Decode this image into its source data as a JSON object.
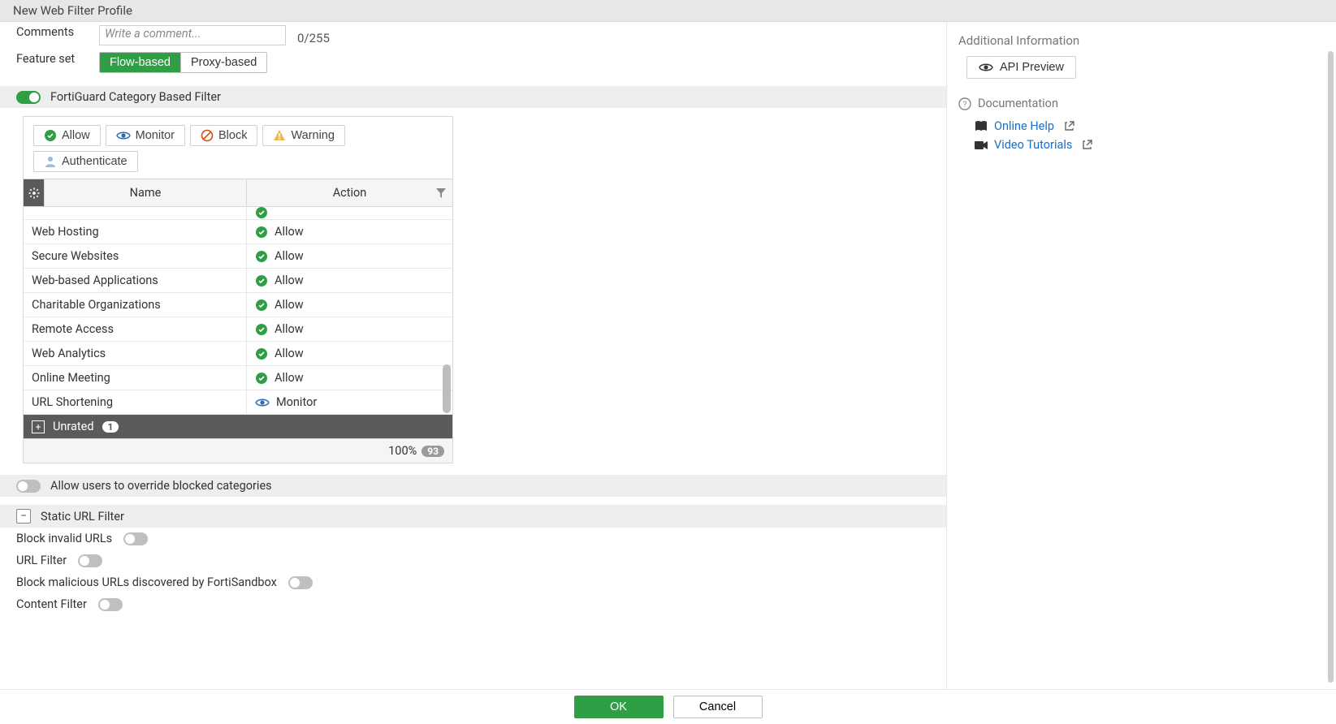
{
  "title": "New Web Filter Profile",
  "comments": {
    "label": "Comments",
    "placeholder": "Write a comment...",
    "value": "",
    "count": "0/255"
  },
  "feature_set": {
    "label": "Feature set",
    "options": [
      "Flow-based",
      "Proxy-based"
    ],
    "selected": "Flow-based"
  },
  "category_filter": {
    "title": "FortiGuard Category Based Filter",
    "enabled": true,
    "action_buttons": {
      "allow": "Allow",
      "monitor": "Monitor",
      "block": "Block",
      "warning": "Warning",
      "authenticate": "Authenticate"
    },
    "columns": {
      "name": "Name",
      "action": "Action"
    },
    "rows": [
      {
        "name": "Web Hosting",
        "action": "Allow",
        "action_type": "allow"
      },
      {
        "name": "Secure Websites",
        "action": "Allow",
        "action_type": "allow"
      },
      {
        "name": "Web-based Applications",
        "action": "Allow",
        "action_type": "allow"
      },
      {
        "name": "Charitable Organizations",
        "action": "Allow",
        "action_type": "allow"
      },
      {
        "name": "Remote Access",
        "action": "Allow",
        "action_type": "allow"
      },
      {
        "name": "Web Analytics",
        "action": "Allow",
        "action_type": "allow"
      },
      {
        "name": "Online Meeting",
        "action": "Allow",
        "action_type": "allow"
      },
      {
        "name": "URL Shortening",
        "action": "Monitor",
        "action_type": "monitor"
      }
    ],
    "group": {
      "label": "Unrated",
      "count": "1"
    },
    "footer": {
      "percent": "100%",
      "total": "93"
    }
  },
  "override": {
    "label": "Allow users to override blocked categories",
    "enabled": false
  },
  "static_url": {
    "title": "Static URL Filter",
    "rows": [
      {
        "label": "Block invalid URLs",
        "enabled": false
      },
      {
        "label": "URL Filter",
        "enabled": false
      },
      {
        "label": "Block malicious URLs discovered by FortiSandbox",
        "enabled": false
      },
      {
        "label": "Content Filter",
        "enabled": false
      }
    ]
  },
  "side": {
    "title": "Additional Information",
    "api_btn": "API Preview",
    "doc_title": "Documentation",
    "links": {
      "online_help": "Online Help",
      "video": "Video Tutorials"
    }
  },
  "footer": {
    "ok": "OK",
    "cancel": "Cancel"
  }
}
